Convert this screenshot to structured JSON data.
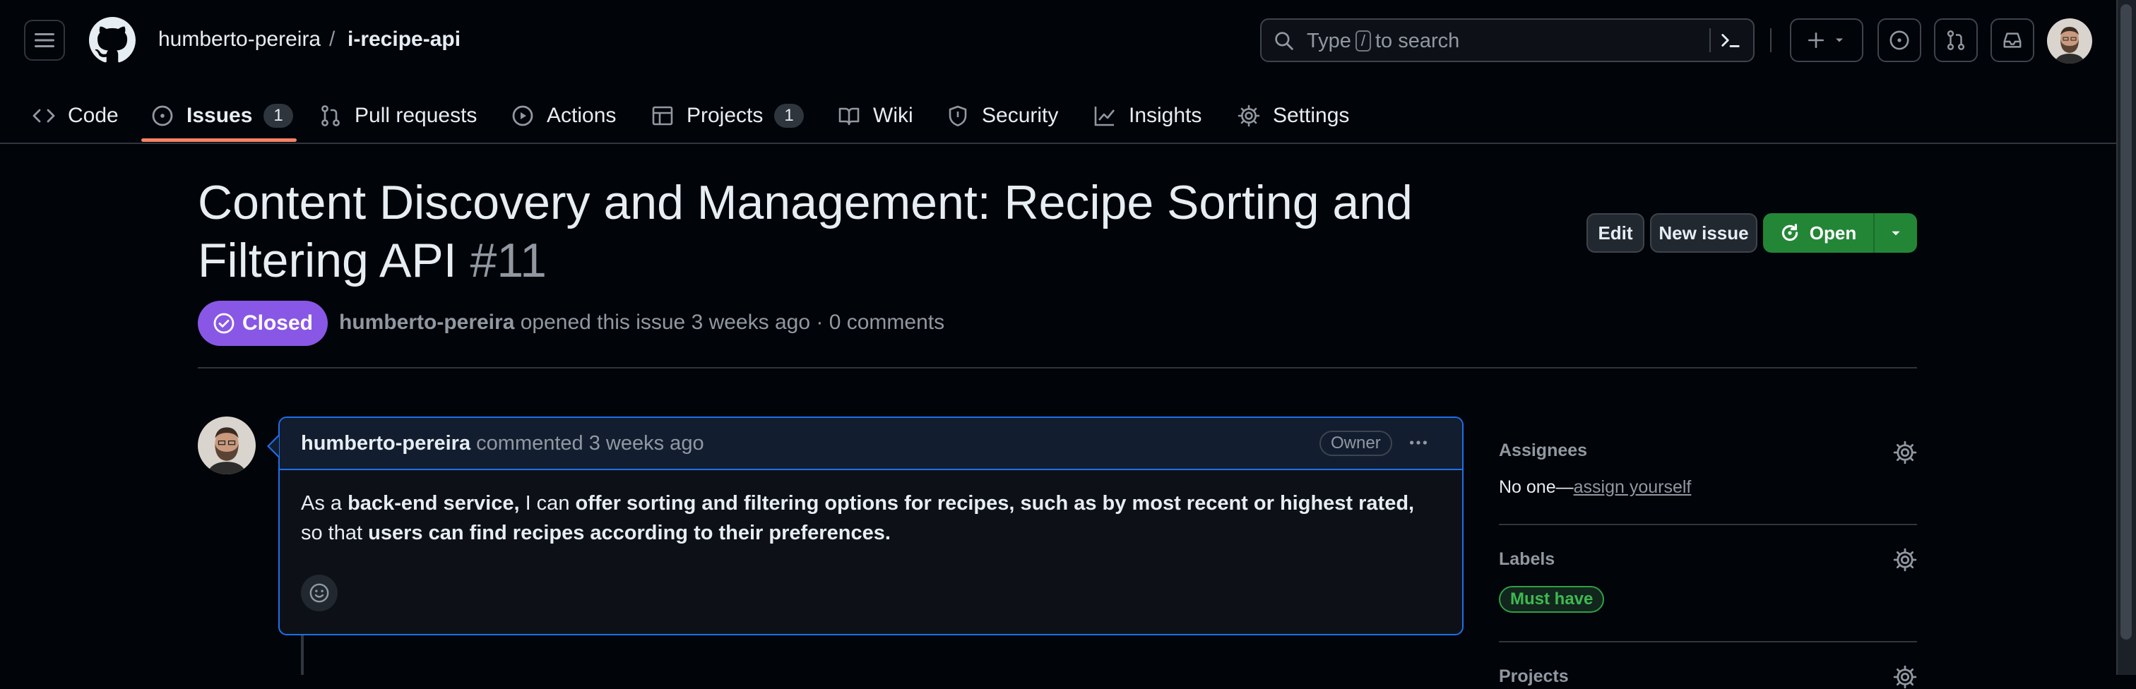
{
  "header": {
    "owner": "humberto-pereira",
    "separator": "/",
    "repo": "i-recipe-api",
    "search": {
      "prefix": "Type",
      "key": "/",
      "suffix": "to search"
    }
  },
  "tabs": [
    {
      "label": "Code",
      "icon": "code-icon"
    },
    {
      "label": "Issues",
      "icon": "issue-opened-icon",
      "count": "1",
      "active": true
    },
    {
      "label": "Pull requests",
      "icon": "git-pull-request-icon"
    },
    {
      "label": "Actions",
      "icon": "play-icon"
    },
    {
      "label": "Projects",
      "icon": "table-icon",
      "count": "1"
    },
    {
      "label": "Wiki",
      "icon": "book-icon"
    },
    {
      "label": "Security",
      "icon": "shield-icon"
    },
    {
      "label": "Insights",
      "icon": "graph-icon"
    },
    {
      "label": "Settings",
      "icon": "gear-icon"
    }
  ],
  "issue": {
    "title": "Content Discovery and Management: Recipe Sorting and Filtering API",
    "number": "#11",
    "state": "Closed",
    "author": "humberto-pereira",
    "opened_text": "opened this issue 3 weeks ago",
    "dot": "·",
    "comments": "0 comments",
    "buttons": {
      "edit": "Edit",
      "new_issue": "New issue",
      "open": "Open"
    }
  },
  "comment": {
    "author": "humberto-pereira",
    "action": "commented 3 weeks ago",
    "role": "Owner",
    "body": [
      {
        "t": "As a ",
        "b": false
      },
      {
        "t": "back-end service,",
        "b": true
      },
      {
        "t": " I can ",
        "b": false
      },
      {
        "t": "offer sorting and filtering options for recipes, such as by most recent or highest rated,",
        "b": true
      },
      {
        "t": " so that ",
        "b": false
      },
      {
        "t": "users can find recipes according to their preferences.",
        "b": true
      }
    ]
  },
  "sidebar": {
    "assignees": {
      "title": "Assignees",
      "none": "No one—",
      "link": "assign yourself"
    },
    "labels": {
      "title": "Labels",
      "items": [
        {
          "name": "Must have",
          "color": "#3fb950"
        }
      ]
    },
    "projects": {
      "title": "Projects"
    }
  },
  "colors": {
    "accent": "#1f6feb",
    "closed": "#8957e5",
    "open": "#238636",
    "tab_underline": "#f78166"
  }
}
